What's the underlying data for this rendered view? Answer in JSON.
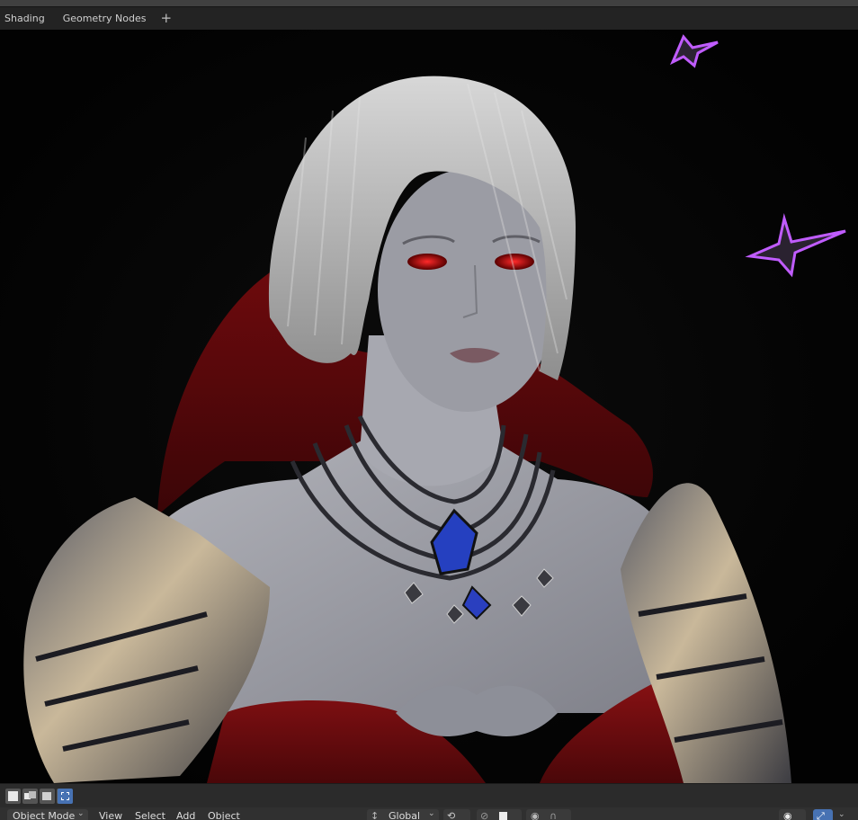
{
  "tabs": {
    "shading": "Shading",
    "geometry_nodes": "Geometry Nodes",
    "add": "+"
  },
  "viewport": {
    "background": "#030303",
    "accent_glow": "#b74dff",
    "cape_color": "#7e0d10",
    "skin_color": "#9c9ea6",
    "hair_color": "#bcbcbc",
    "gem_color": "#2a3fbf"
  },
  "select_modes": [
    "select-set-icon",
    "select-extend-icon",
    "select-subtract-icon",
    "select-invert-icon",
    "select-intersect-icon"
  ],
  "header": {
    "mode": "Object Mode",
    "menu_view": "View",
    "menu_select": "Select",
    "menu_add": "Add",
    "menu_object": "Object",
    "orientation": "Global",
    "chevron": "⌄"
  },
  "colors": {
    "accent": "#4772b3",
    "panel": "#303030"
  }
}
